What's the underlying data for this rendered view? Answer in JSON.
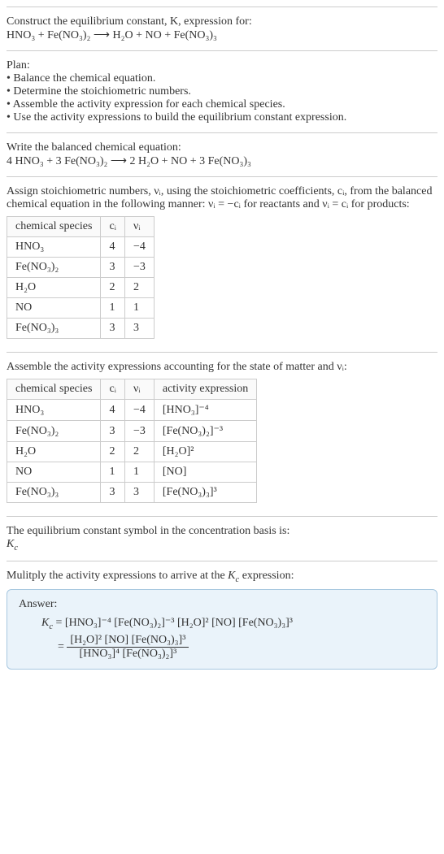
{
  "intro": {
    "line1": "Construct the equilibrium constant, K, expression for:",
    "equation": "HNO₃ + Fe(NO₃)₂ ⟶ H₂O + NO + Fe(NO₃)₃"
  },
  "plan": {
    "heading": "Plan:",
    "b1": "• Balance the chemical equation.",
    "b2": "• Determine the stoichiometric numbers.",
    "b3": "• Assemble the activity expression for each chemical species.",
    "b4": "• Use the activity expressions to build the equilibrium constant expression."
  },
  "balanced": {
    "heading": "Write the balanced chemical equation:",
    "equation": "4 HNO₃ + 3 Fe(NO₃)₂ ⟶ 2 H₂O + NO + 3 Fe(NO₃)₃"
  },
  "stoich": {
    "text": "Assign stoichiometric numbers, νᵢ, using the stoichiometric coefficients, cᵢ, from the balanced chemical equation in the following manner: νᵢ = −cᵢ for reactants and νᵢ = cᵢ for products:",
    "h_species": "chemical species",
    "h_ci": "cᵢ",
    "h_vi": "νᵢ",
    "rows": [
      {
        "species": "HNO₃",
        "ci": "4",
        "vi": "−4"
      },
      {
        "species": "Fe(NO₃)₂",
        "ci": "3",
        "vi": "−3"
      },
      {
        "species": "H₂O",
        "ci": "2",
        "vi": "2"
      },
      {
        "species": "NO",
        "ci": "1",
        "vi": "1"
      },
      {
        "species": "Fe(NO₃)₃",
        "ci": "3",
        "vi": "3"
      }
    ]
  },
  "activity": {
    "heading": "Assemble the activity expressions accounting for the state of matter and νᵢ:",
    "h_species": "chemical species",
    "h_ci": "cᵢ",
    "h_vi": "νᵢ",
    "h_act": "activity expression",
    "rows": [
      {
        "species": "HNO₃",
        "ci": "4",
        "vi": "−4",
        "act": "[HNO₃]⁻⁴"
      },
      {
        "species": "Fe(NO₃)₂",
        "ci": "3",
        "vi": "−3",
        "act": "[Fe(NO₃)₂]⁻³"
      },
      {
        "species": "H₂O",
        "ci": "2",
        "vi": "2",
        "act": "[H₂O]²"
      },
      {
        "species": "NO",
        "ci": "1",
        "vi": "1",
        "act": "[NO]"
      },
      {
        "species": "Fe(NO₃)₃",
        "ci": "3",
        "vi": "3",
        "act": "[Fe(NO₃)₃]³"
      }
    ]
  },
  "symbol": {
    "line1": "The equilibrium constant symbol in the concentration basis is:",
    "line2": "K_c"
  },
  "multiply": {
    "heading": "Mulitply the activity expressions to arrive at the K_c expression:"
  },
  "answer": {
    "label": "Answer:",
    "lhs": "K_c =",
    "rhs1": "[HNO₃]⁻⁴ [Fe(NO₃)₂]⁻³ [H₂O]² [NO] [Fe(NO₃)₃]³",
    "eq2": "=",
    "num": "[H₂O]² [NO] [Fe(NO₃)₃]³",
    "den": "[HNO₃]⁴ [Fe(NO₃)₂]³"
  }
}
